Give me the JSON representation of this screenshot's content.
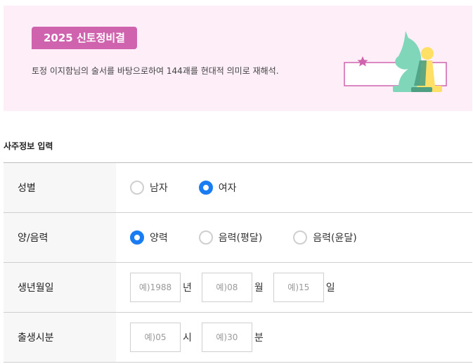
{
  "banner": {
    "badge": "2025 신토정비결",
    "description": "토정 이지함님의 술서를 바탕으로하여 144괘를 현대적 의미로 재해석.",
    "colors": {
      "background": "#fdeef8",
      "badge": "#cf63ae"
    },
    "illustration_icons": [
      "star-icon",
      "chess-knight-icon",
      "chess-pawn-icon"
    ]
  },
  "form": {
    "title": "사주정보 입력",
    "gender": {
      "label": "성별",
      "options": [
        {
          "label": "남자",
          "checked": false
        },
        {
          "label": "여자",
          "checked": true
        }
      ]
    },
    "calendar": {
      "label": "양/음력",
      "options": [
        {
          "label": "양력",
          "checked": true
        },
        {
          "label": "음력(평달)",
          "checked": false
        },
        {
          "label": "음력(윤달)",
          "checked": false
        }
      ]
    },
    "birthdate": {
      "label": "생년월일",
      "year": {
        "placeholder": "예)1988",
        "unit": "년"
      },
      "month": {
        "placeholder": "예)08",
        "unit": "월"
      },
      "day": {
        "placeholder": "예)15",
        "unit": "일"
      }
    },
    "birthtime": {
      "label": "출생시분",
      "hour": {
        "placeholder": "예)05",
        "unit": "시"
      },
      "minute": {
        "placeholder": "예)30",
        "unit": "분"
      }
    },
    "accent_color": "#1a7cf2"
  }
}
